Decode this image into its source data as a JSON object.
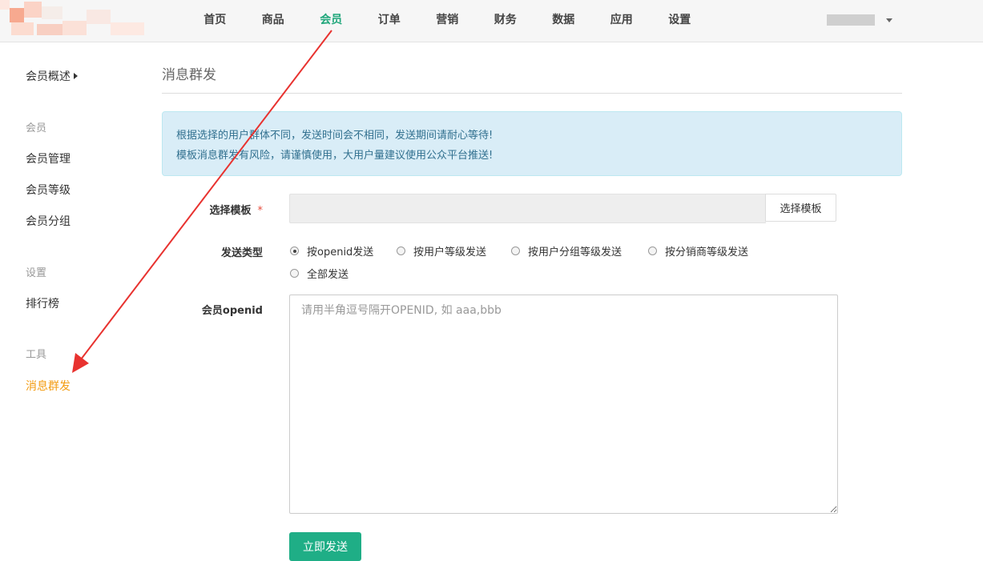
{
  "nav": {
    "items": [
      "首页",
      "商品",
      "会员",
      "订单",
      "营销",
      "财务",
      "数据",
      "应用",
      "设置"
    ],
    "active_index": 2,
    "user": {
      "name": ""
    }
  },
  "sidebar": {
    "overview": "会员概述",
    "group_member": "会员",
    "manage": "会员管理",
    "level": "会员等级",
    "group": "会员分组",
    "group_settings": "设置",
    "ranking": "排行榜",
    "group_tools": "工具",
    "broadcast": "消息群发"
  },
  "main": {
    "title": "消息群发",
    "alert": {
      "line1": "根据选择的用户群体不同，发送时间会不相同，发送期间请耐心等待!",
      "line2": "模板消息群发有风险，请谨慎使用，大用户量建议使用公众平台推送!"
    },
    "template": {
      "label": "选择模板",
      "required_mark": "*",
      "value": "",
      "button": "选择模板"
    },
    "send_type": {
      "label": "发送类型",
      "options": [
        "按openid发送",
        "按用户等级发送",
        "按用户分组等级发送",
        "按分销商等级发送",
        "全部发送"
      ],
      "selected_index": 0
    },
    "openid": {
      "label": "会员openid",
      "placeholder": "请用半角逗号隔开OPENID, 如 aaa,bbb",
      "value": ""
    },
    "submit": "立即发送"
  },
  "colors": {
    "accent": "#1fa67a",
    "sidebar_active": "#f39c12",
    "annotation_arrow": "#e8322f"
  }
}
